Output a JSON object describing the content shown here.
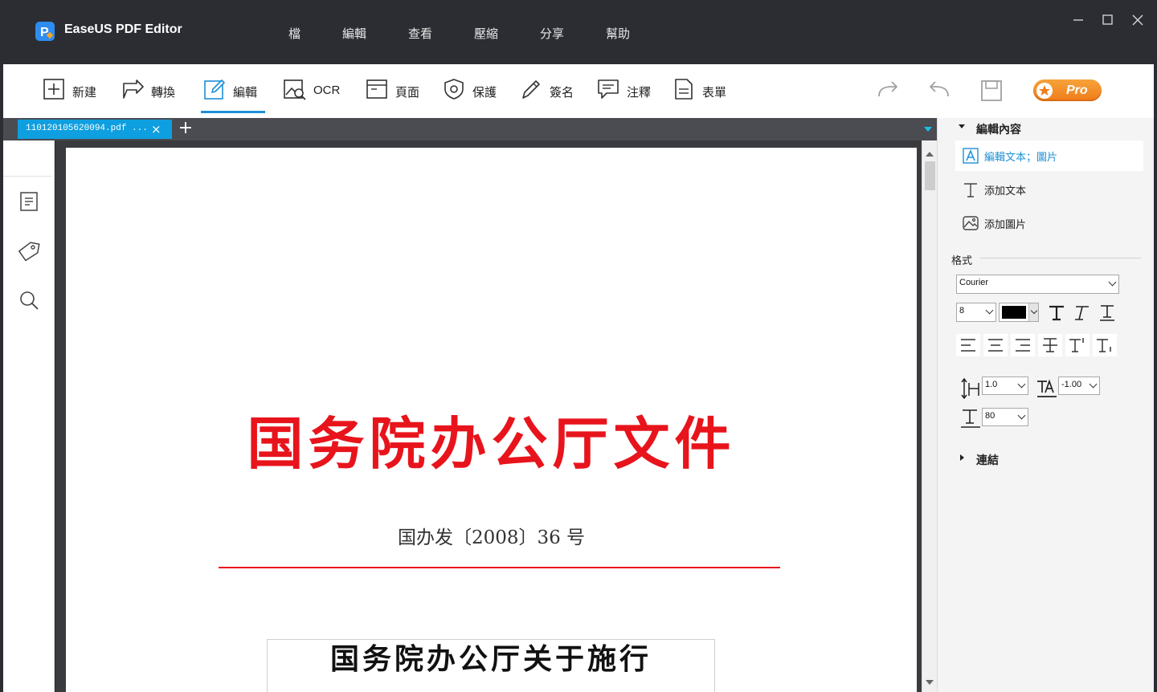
{
  "app": {
    "title": "EaseUS PDF Editor",
    "menu": [
      "檔",
      "編輯",
      "查看",
      "壓縮",
      "分享",
      "幫助"
    ]
  },
  "toolbar": {
    "tools": [
      "新建",
      "轉換",
      "編輯",
      "OCR",
      "頁面",
      "保護",
      "簽名",
      "注釋",
      "表單"
    ],
    "active": "編輯",
    "pro_label": "Pro"
  },
  "tab": {
    "filename": "110120105620094.pdf ...",
    "close": "×",
    "add": "+"
  },
  "document": {
    "header": "国务院办公厅文件",
    "number": "国办发〔2008〕36 号",
    "subtitle": "国务院办公厅关于施行"
  },
  "panel": {
    "edit_section": "編輯內容",
    "items": [
      "編輯文本；圖片",
      "添加文本",
      "添加圖片"
    ],
    "format_label": "格式",
    "font": "Courier",
    "font_size": "8",
    "color": "#000000",
    "line_spacing": "1.0",
    "char_spacing": "-1.00",
    "scale": "80",
    "link_section": "連結"
  },
  "colors": {
    "accent": "#1e90d6",
    "tab_active": "#0e9fe0",
    "doc_red": "#e8141c",
    "pro_orange": "#f29a2e"
  }
}
